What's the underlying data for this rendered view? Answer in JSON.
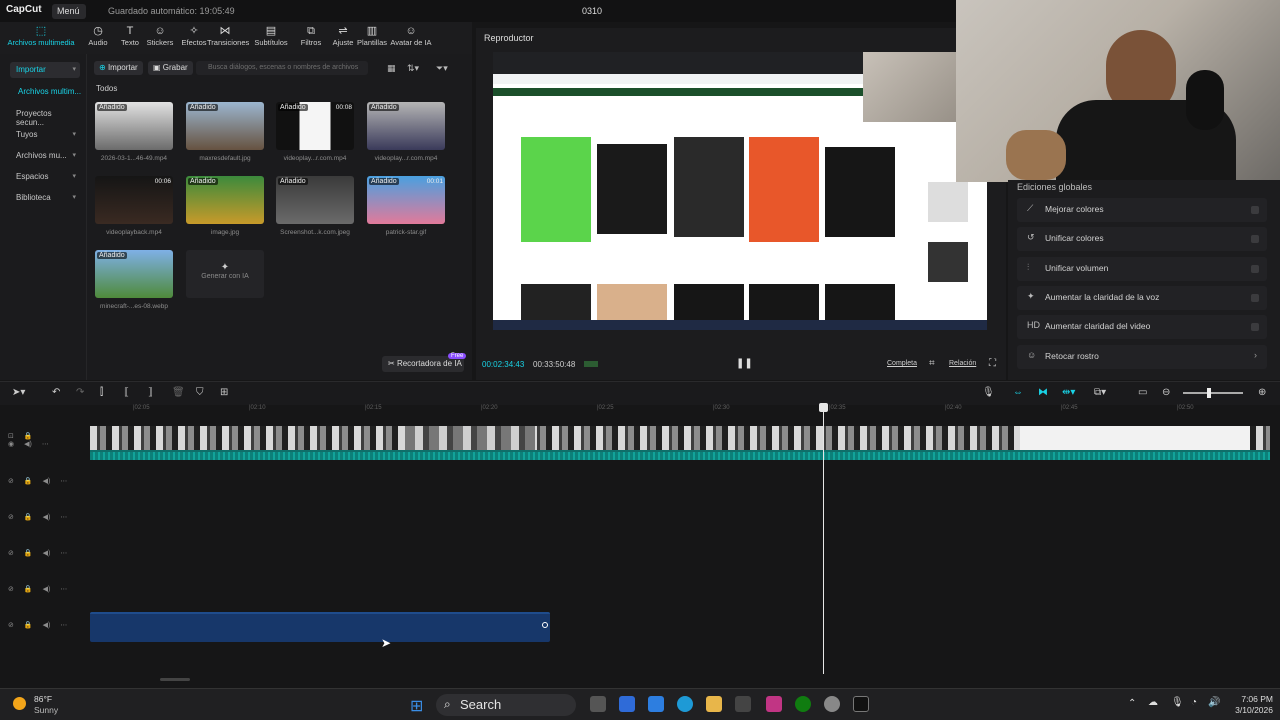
{
  "app": {
    "logo": "CapCut",
    "menu": "Menú",
    "autosave": "Guardado automático: 19:05:49",
    "project_title": "0310"
  },
  "toolbar": [
    {
      "label": "Archivos multimedia",
      "icon": "media-icon",
      "active": true
    },
    {
      "label": "Audio",
      "icon": "audio-icon"
    },
    {
      "label": "Texto",
      "icon": "text-icon"
    },
    {
      "label": "Stickers",
      "icon": "sticker-icon"
    },
    {
      "label": "Efectos",
      "icon": "effects-icon"
    },
    {
      "label": "Transiciones",
      "icon": "transition-icon"
    },
    {
      "label": "Subtítulos",
      "icon": "subtitles-icon"
    },
    {
      "label": "Filtros",
      "icon": "filter-icon"
    },
    {
      "label": "Ajuste",
      "icon": "adjust-icon"
    },
    {
      "label": "Plantillas",
      "icon": "templates-icon"
    },
    {
      "label": "Avatar de IA",
      "icon": "avatar-icon"
    }
  ],
  "leftnav": {
    "items": [
      "Importar",
      "Archivos multim...",
      "Proyectos secun...",
      "Tuyos",
      "Archivos mu...",
      "Espacios",
      "Biblioteca"
    ]
  },
  "media": {
    "import_button": "Importar",
    "record_button": "Grabar",
    "search_placeholder": "Busca diálogos, escenas o nombres de archivos",
    "filter_label": "Todos",
    "tag": "Añadido",
    "items": [
      {
        "name": "2026-03-1...46-49.mp4",
        "duration": ""
      },
      {
        "name": "maxresdefault.jpg",
        "duration": ""
      },
      {
        "name": "videoplay...r.com.mp4",
        "duration": "00:08"
      },
      {
        "name": "videoplay...r.com.mp4",
        "duration": ""
      },
      {
        "name": "videoplayback.mp4",
        "duration": "00:06"
      },
      {
        "name": "image.jpg",
        "duration": ""
      },
      {
        "name": "Screenshot...k.com.jpeg",
        "duration": ""
      },
      {
        "name": "patrick-star.gif",
        "duration": "00:01"
      },
      {
        "name": "minecraft-...es-08.webp",
        "duration": ""
      }
    ],
    "generate_label": "Generar con IA",
    "cutout_button": "Recortadora de IA",
    "cutout_badge": "Free"
  },
  "player": {
    "title": "Reproductor",
    "current_time": "00:02:34:43",
    "total_time": "00:33:50:48",
    "fullscreen_label": "Completa",
    "ratio_label": "Relación"
  },
  "right_panel": {
    "title": "Ediciones globales",
    "options": [
      "Mejorar colores",
      "Unificar colores",
      "Unificar volumen",
      "Aumentar la claridad de la voz",
      "Aumentar claridad del video",
      "Retocar rostro"
    ],
    "option_icons": [
      "wand-icon",
      "unify-icon",
      "volume-icon",
      "voice-icon",
      "hd-icon",
      "face-icon"
    ],
    "option_glyphs": [
      "⟋",
      "↺",
      "⫶",
      "✦",
      "HD",
      "☺"
    ]
  },
  "ruler": {
    "ticks": [
      "|02:05",
      "|02:10",
      "|02:15",
      "|02:20",
      "|02:25",
      "|02:30",
      "|02:35",
      "|02:40",
      "|02:45",
      "|02:50"
    ]
  },
  "taskbar": {
    "temperature": "86°F",
    "weather": "Sunny",
    "search": "Search",
    "time": "7:06 PM",
    "date": "3/10/2026"
  },
  "colors": {
    "accent": "#19d3e6",
    "video_track": "#0f6f6a",
    "audio_track": "#17376a"
  }
}
